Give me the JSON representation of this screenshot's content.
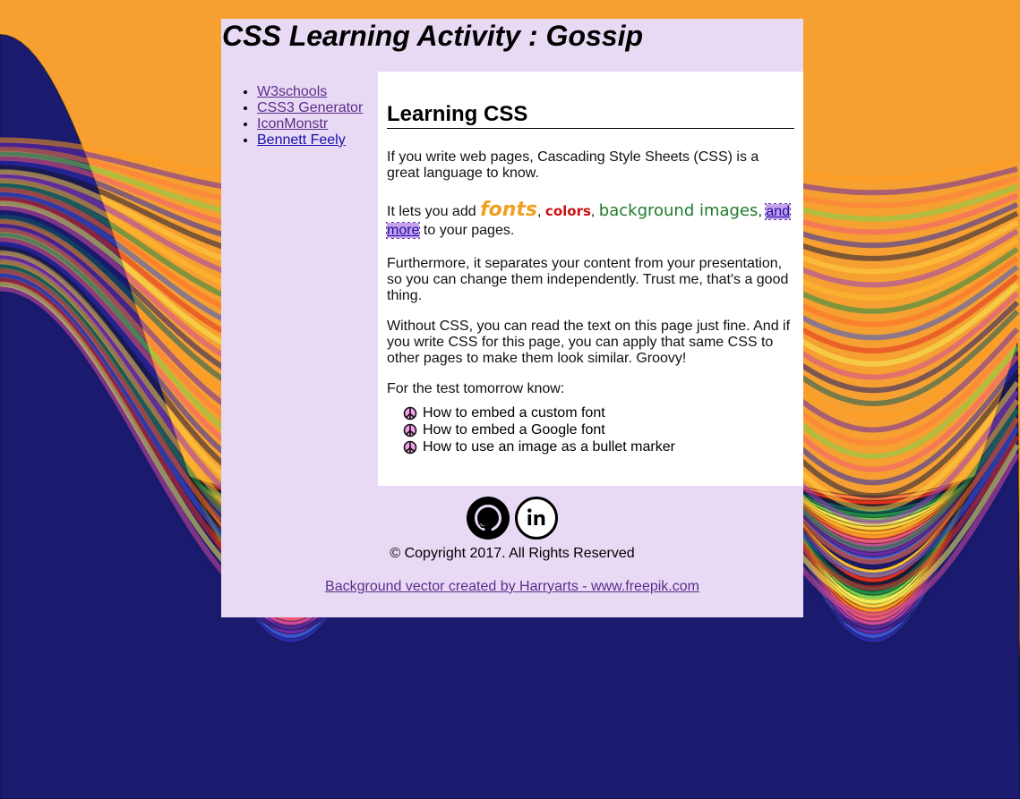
{
  "header": {
    "title": "CSS Learning Activity : Gossip"
  },
  "sidebar": {
    "links": [
      {
        "label": "W3schools"
      },
      {
        "label": "CSS3 Generator"
      },
      {
        "label": "IconMonstr"
      },
      {
        "label": "Bennett Feely"
      }
    ]
  },
  "main": {
    "heading": "Learning CSS",
    "p1": "If you write web pages, Cascading Style Sheets (CSS) is a great language to know.",
    "p2": {
      "before": "It lets you add ",
      "fonts": "fonts",
      "comma1": ", ",
      "colors": "colors",
      "comma2": ", ",
      "background": "background images",
      "comma3": ", ",
      "more": "and more",
      "after": " to your pages."
    },
    "p3": "Furthermore, it separates your content from your presentation, so you can change them independently. Trust me, that's a good thing.",
    "p4": "Without CSS, you can read the text on this page just fine. And if you write CSS for this page, you can apply that same CSS to other pages to make them look similar. Groovy!",
    "p5": "For the test tomorrow know:",
    "test_items": [
      {
        "label": "How to embed a custom font"
      },
      {
        "label": "How to embed a Google font"
      },
      {
        "label": "How to use an image as a bullet marker"
      }
    ]
  },
  "footer": {
    "icons": [
      "github-icon",
      "linkedin-icon"
    ],
    "copyright": "© Copyright 2017. All Rights Reserved",
    "credit": "Background vector created by Harryarts - www.freepik.com"
  },
  "colors": {
    "panel": "#e8daf5",
    "content": "#ffffff",
    "link": "#5b2c8a",
    "fonts_word": "#f0a020",
    "colors_word": "#cc1111",
    "background_word": "#1e7a2a"
  }
}
